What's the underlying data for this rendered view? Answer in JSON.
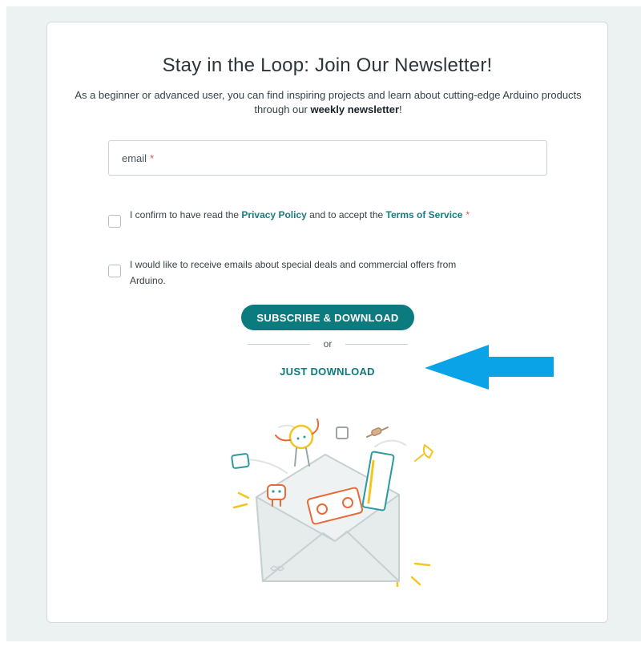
{
  "newsletter": {
    "title": "Stay in the Loop: Join Our Newsletter!",
    "subtitle_prefix": "As a beginner or advanced user, you can find inspiring projects and learn about cutting-edge Arduino products through our ",
    "subtitle_bold": "weekly newsletter",
    "subtitle_suffix": "!",
    "email": {
      "placeholder": "email",
      "required_mark": "*"
    },
    "consent_privacy": {
      "text_before": "I confirm to have read the ",
      "privacy_link": "Privacy Policy",
      "text_middle": " and to accept the ",
      "terms_link": "Terms of Service",
      "required_mark": "*",
      "checked": false
    },
    "consent_marketing": {
      "text": "I would like to receive emails about special deals and commercial offers from Arduino.",
      "checked": false
    },
    "subscribe_button": "SUBSCRIBE & DOWNLOAD",
    "divider_text": "or",
    "just_download_link": "JUST DOWNLOAD"
  },
  "colors": {
    "accent": "#0c7b7f",
    "required": "#da5b4a",
    "page_bg": "#ecf1f1",
    "arrow": "#0ba3e8"
  },
  "icons": {
    "annotation_arrow": "left-arrow-icon",
    "illustration": "newsletter-envelope-illustration"
  }
}
